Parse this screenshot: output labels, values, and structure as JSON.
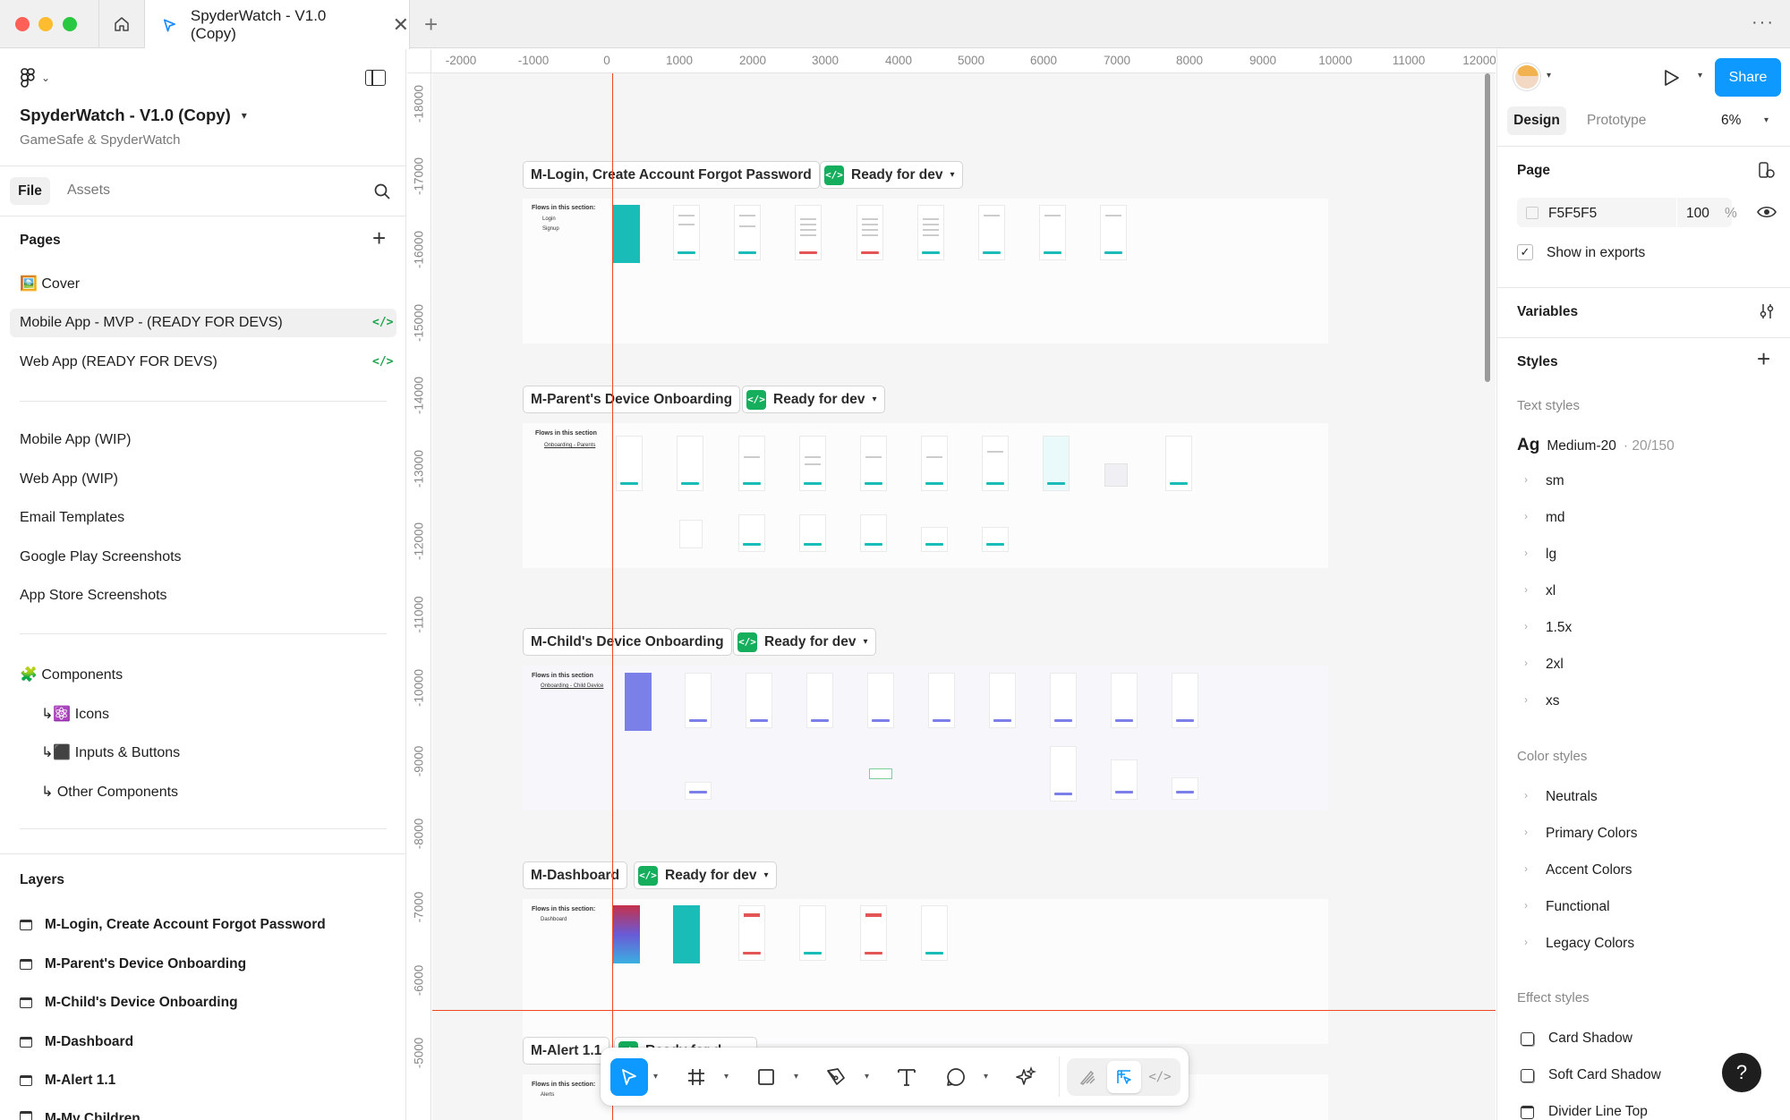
{
  "window": {
    "tab_title": "SpyderWatch - V1.0 (Copy)"
  },
  "left_panel": {
    "file_name": "SpyderWatch - V1.0 (Copy)",
    "team_name": "GameSafe & SpyderWatch",
    "tabs": [
      "File",
      "Assets"
    ],
    "pages_heading": "Pages",
    "pages": [
      "🖼️ Cover",
      "Mobile App - MVP - (READY FOR DEVS)",
      "Web App (READY FOR DEVS)",
      "Mobile App (WIP)",
      "Web App (WIP)",
      "Email Templates",
      "Google Play Screenshots",
      "App Store Screenshots",
      "🧩 Components",
      "↳⚛️ Icons",
      "↳⬛ Inputs & Buttons",
      "↳ Other Components"
    ],
    "layers_heading": "Layers",
    "layers": [
      "M-Login, Create Account Forgot Password",
      "M-Parent's Device Onboarding",
      "M-Child's Device Onboarding",
      "M-Dashboard",
      "M-Alert 1.1",
      "M-My Children"
    ]
  },
  "ruler": {
    "x_ticks": [
      "-2000",
      "-1000",
      "0",
      "1000",
      "2000",
      "3000",
      "4000",
      "5000",
      "6000",
      "7000",
      "8000",
      "9000",
      "10000",
      "11000",
      "12000"
    ],
    "y_ticks": [
      "-18000",
      "-17000",
      "-16000",
      "-15000",
      "-14000",
      "-13000",
      "-12000",
      "-11000",
      "-10000",
      "-9000",
      "-8000",
      "-7000",
      "-6000",
      "-5000"
    ]
  },
  "canvas": {
    "ready_label": "Ready for dev",
    "sections": [
      {
        "name": "M-Login, Create Account Forgot Password",
        "flows_title": "Flows in this section:",
        "flows": [
          "Login",
          "Signup"
        ]
      },
      {
        "name": "M-Parent's Device Onboarding",
        "flows_title": "Flows in this section",
        "flows": [
          "Onboarding - Parents"
        ]
      },
      {
        "name": "M-Child's Device Onboarding",
        "flows_title": "Flows in this section",
        "flows": [
          "Onboarding - Child Device"
        ]
      },
      {
        "name": "M-Dashboard",
        "flows_title": "Flows in this section:",
        "flows": [
          "Dashboard"
        ]
      },
      {
        "name": "M-Alert 1.1",
        "flows_title": "Flows in this section:",
        "flows": [
          "Alerts"
        ]
      }
    ],
    "partial_ready_label": "Ready for d..."
  },
  "right_panel": {
    "share_label": "Share",
    "tabs": [
      "Design",
      "Prototype"
    ],
    "zoom": "6%",
    "page_heading": "Page",
    "page_color": "F5F5F5",
    "page_opacity": "100",
    "percent": "%",
    "show_in_exports": "Show in exports",
    "variables_heading": "Variables",
    "styles_heading": "Styles",
    "text_styles_heading": "Text styles",
    "text_style_main": {
      "glyph": "Ag",
      "name": "Medium-20",
      "meta": "· 20/150"
    },
    "text_styles": [
      "sm",
      "md",
      "lg",
      "xl",
      "1.5x",
      "2xl",
      "xs"
    ],
    "color_styles_heading": "Color styles",
    "color_styles": [
      "Neutrals",
      "Primary Colors",
      "Accent Colors",
      "Functional",
      "Legacy Colors"
    ],
    "effect_styles_heading": "Effect styles",
    "effect_styles": [
      "Card Shadow",
      "Soft Card Shadow",
      "Divider Line Top"
    ],
    "help": "?"
  },
  "colors": {
    "accent_blue": "#0d99ff",
    "ready_green": "#14ae5c",
    "teal": "#1abcb7",
    "purple": "#7b80e8",
    "guide_red": "#f24822"
  }
}
